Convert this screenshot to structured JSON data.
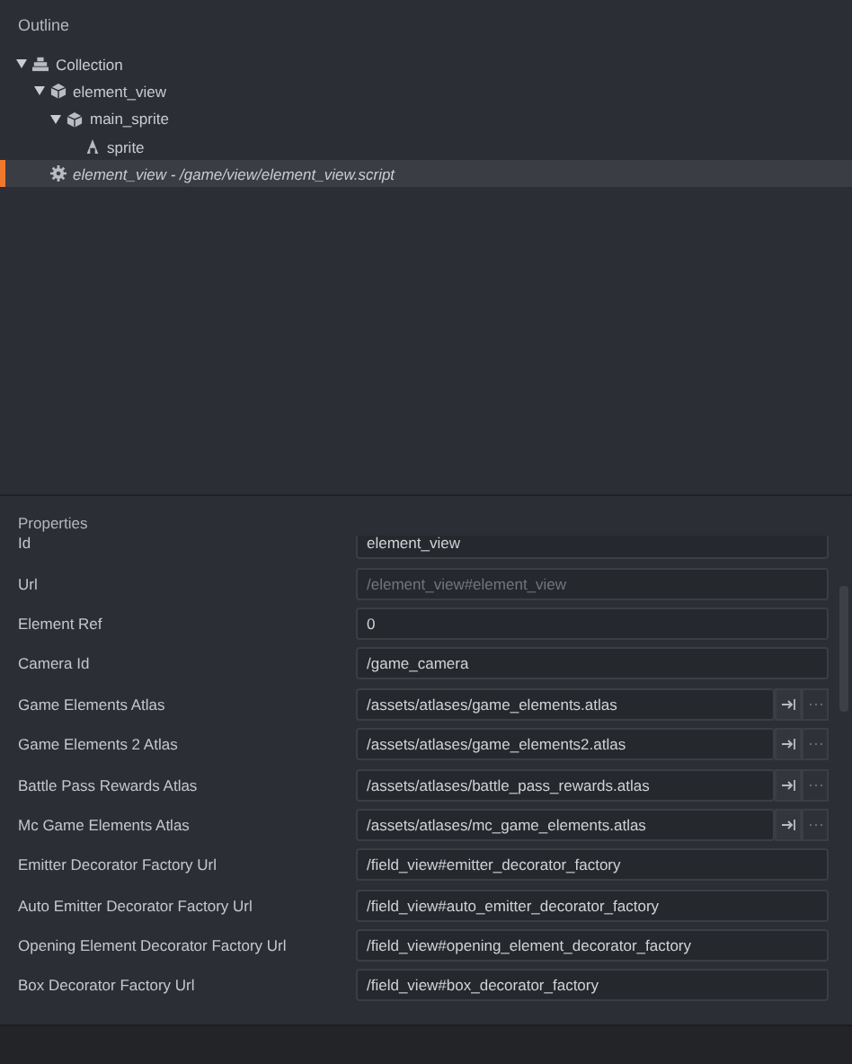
{
  "outline": {
    "title": "Outline",
    "tree": [
      {
        "label": "Collection",
        "kind": "collection",
        "expanded": true,
        "selected": false,
        "children": [
          {
            "label": "element_view",
            "kind": "game_object",
            "expanded": true,
            "selected": false,
            "children": [
              {
                "label": "main_sprite",
                "kind": "game_object",
                "expanded": true,
                "selected": false,
                "children": [
                  {
                    "label": "sprite",
                    "kind": "sprite",
                    "selected": false
                  }
                ]
              }
            ]
          },
          {
            "label": "element_view - /game/view/element_view.script",
            "kind": "script",
            "selected": true
          }
        ]
      }
    ]
  },
  "properties": {
    "title": "Properties",
    "rows": [
      {
        "label": "Id",
        "value": "element_view",
        "kind": "text",
        "disabled": false
      },
      {
        "label": "Url",
        "value": "/element_view#element_view",
        "kind": "text",
        "disabled": true
      },
      {
        "label": "Element Ref",
        "value": "0",
        "kind": "text",
        "disabled": false
      },
      {
        "label": "Camera Id",
        "value": "/game_camera",
        "kind": "text",
        "disabled": false
      },
      {
        "label": "Game Elements Atlas",
        "value": "/assets/atlases/game_elements.atlas",
        "kind": "resource",
        "disabled": false
      },
      {
        "label": "Game Elements 2 Atlas",
        "value": "/assets/atlases/game_elements2.atlas",
        "kind": "resource",
        "disabled": false
      },
      {
        "label": "Battle Pass Rewards Atlas",
        "value": "/assets/atlases/battle_pass_rewards.atlas",
        "kind": "resource",
        "disabled": false
      },
      {
        "label": "Mc Game Elements Atlas",
        "value": "/assets/atlases/mc_game_elements.atlas",
        "kind": "resource",
        "disabled": false
      },
      {
        "label": "Emitter Decorator Factory Url",
        "value": "/field_view#emitter_decorator_factory",
        "kind": "text",
        "disabled": false
      },
      {
        "label": "Auto Emitter Decorator Factory Url",
        "value": "/field_view#auto_emitter_decorator_factory",
        "kind": "text",
        "disabled": false
      },
      {
        "label": "Opening Element Decorator Factory Url",
        "value": "/field_view#opening_element_decorator_factory",
        "kind": "text",
        "disabled": false
      },
      {
        "label": "Box Decorator Factory Url",
        "value": "/field_view#box_decorator_factory",
        "kind": "text",
        "disabled": false
      }
    ]
  }
}
